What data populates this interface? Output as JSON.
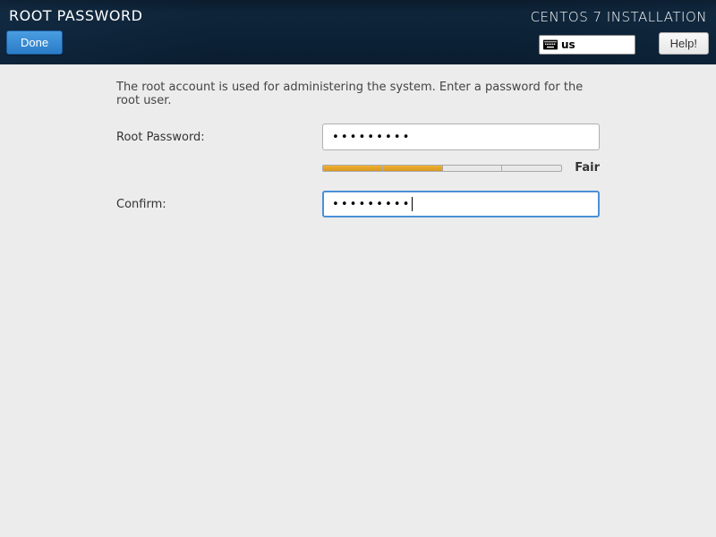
{
  "header": {
    "title_left": "ROOT PASSWORD",
    "title_right": "CENTOS 7 INSTALLATION",
    "done_label": "Done",
    "keyboard_layout": "us",
    "help_label": "Help!"
  },
  "form": {
    "instruction": "The root account is used for administering the system.  Enter a password for the root user.",
    "password_label": "Root Password:",
    "password_value": "•••••••••",
    "confirm_label": "Confirm:",
    "confirm_value": "•••••••••",
    "strength": {
      "label": "Fair",
      "filled_segments": 2,
      "total_segments": 4
    }
  }
}
